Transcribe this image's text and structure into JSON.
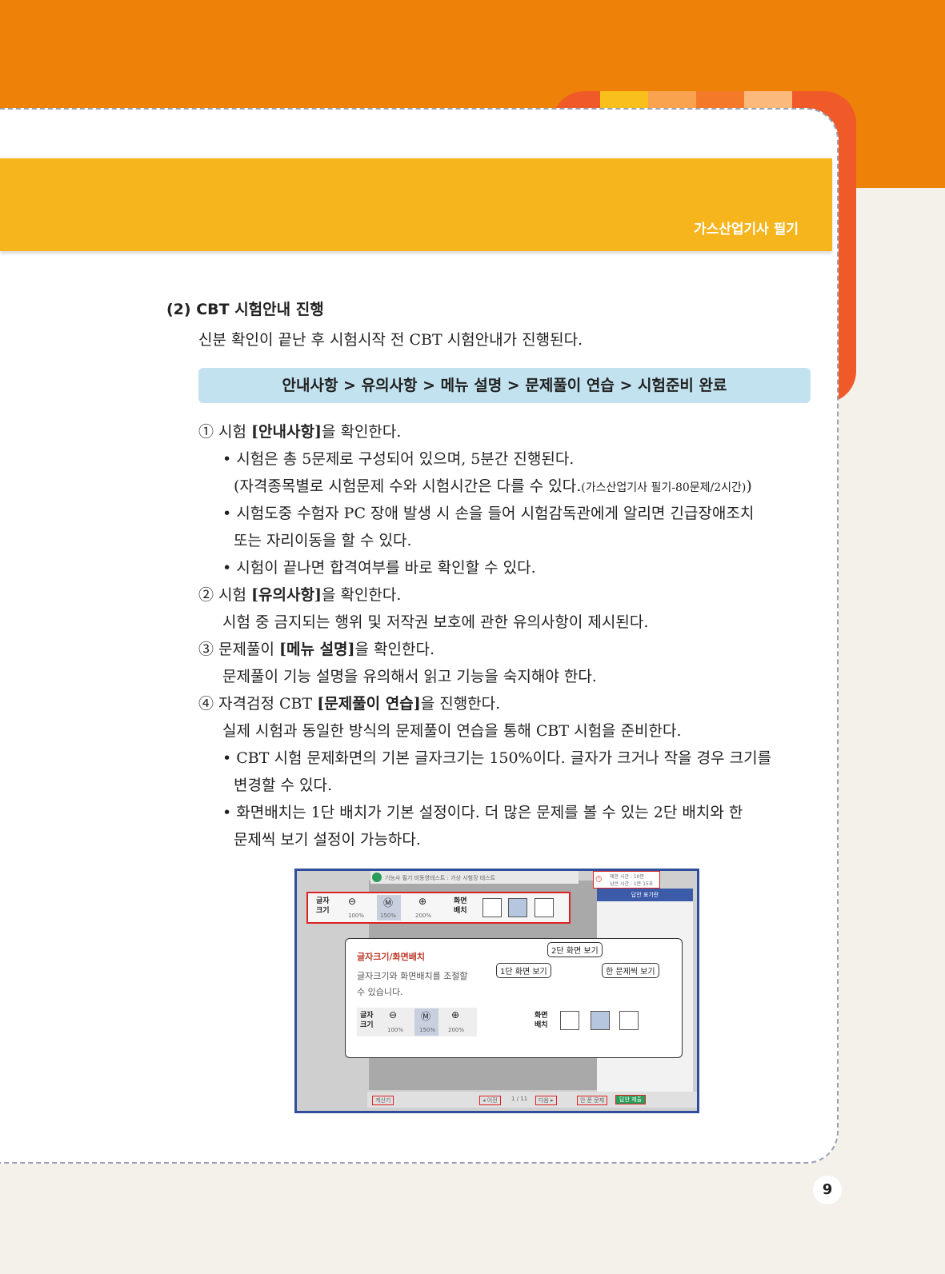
{
  "header": {
    "title": "가스산업기사 필기"
  },
  "section": {
    "title": "(2) CBT 시험안내 진행"
  },
  "intro": "신분 확인이 끝난 후 시험시작 전 CBT 시험안내가 진행된다.",
  "flow": "안내사항 > 유의사항 > 메뉴 설명 > 문제풀이 연습 > 시험준비 완료",
  "items": {
    "i1_pre": "① 시험 ",
    "i1_bold": "[안내사항]",
    "i1_post": "을 확인한다.",
    "i1_b1": "• 시험은 총 5문제로 구성되어 있으며, 5분간 진행된다.",
    "i1_b1_note": "(자격종목별로 시험문제 수와 시험시간은 다를 수 있다.",
    "i1_b1_small": "(가스산업기사 필기-80문제/2시간)",
    "i1_b1_close": ")",
    "i1_b2a": "• 시험도중 수험자 PC 장애 발생 시 손을 들어 시험감독관에게 알리면 긴급장애조치",
    "i1_b2b": "또는 자리이동을 할 수 있다.",
    "i1_b3": "• 시험이 끝나면 합격여부를 바로 확인할 수 있다.",
    "i2_pre": "② 시험 ",
    "i2_bold": "[유의사항]",
    "i2_post": "을 확인한다.",
    "i2_desc": "시험 중 금지되는 행위 및 저작권 보호에 관한 유의사항이 제시된다.",
    "i3_pre": "③ 문제풀이 ",
    "i3_bold": "[메뉴 설명]",
    "i3_post": "을 확인한다.",
    "i3_desc": "문제풀이 기능 설명을 유의해서 읽고 기능을 숙지해야 한다.",
    "i4_pre": "④ 자격검정 CBT ",
    "i4_bold": "[문제풀이 연습]",
    "i4_post": "을 진행한다.",
    "i4_desc": "실제 시험과 동일한 방식의 문제풀이 연습을 통해 CBT 시험을 준비한다.",
    "i4_b1a": "• CBT 시험 문제화면의 기본 글자크기는 150%이다. 글자가 크거나 작을 경우 크기를",
    "i4_b1b": "변경할 수 있다.",
    "i4_b2a": "• 화면배치는 1단 배치가 기본 설정이다. 더 많은 문제를 볼 수 있는 2단 배치와 한",
    "i4_b2b": "문제씩 보기 설정이 가능하다."
  },
  "screenshot": {
    "top_title": "기능사 필기 비동영테스트 : 가상 시험장 테스트",
    "font_size_label": "글자\n크기",
    "zoom": [
      "100%",
      "150%",
      "200%"
    ],
    "layout_label": "화면\n배치",
    "answer_panel": "답안 표기란",
    "popup_title": "글자크기/화면배치",
    "popup_desc1": "글자크기와 화면배치를 조절할",
    "popup_desc2": "수 있습니다.",
    "callout_2col": "2단 화면 보기",
    "callout_1col": "1단 화면 보기",
    "callout_single": "한 문제씩 보기",
    "calc": "계산기",
    "prev": "◂ 이전",
    "page": "1 / 11",
    "next": "다음 ▸",
    "unsolved": "안 푼 문제",
    "submit": "답안 제출",
    "remaining": "제한 시간 : 10분",
    "remaining2": "남은 시간 : 1분 15초"
  },
  "page_number": "9"
}
